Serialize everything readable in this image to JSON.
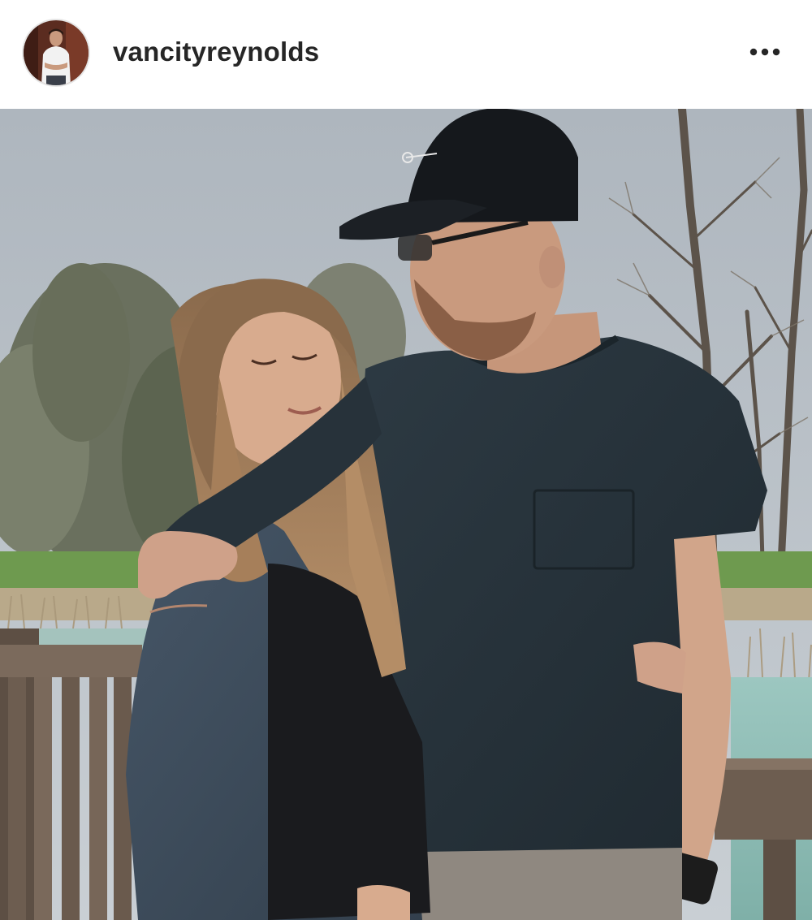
{
  "post": {
    "username": "vancityreynolds",
    "avatar_icon": "profile-avatar",
    "more_icon": "more-options-icon",
    "photo_alt": "vancityreynolds"
  },
  "colors": {
    "username": "#262626",
    "sky": "#b9c1c9",
    "grass": "#6d9a4e",
    "tshirt": "#27323a",
    "cap": "#15181c",
    "cardigan": "#3c4b5a",
    "hair": "#9c7a58",
    "railing": "#6b5a4c",
    "water": "#8fbdb4"
  }
}
